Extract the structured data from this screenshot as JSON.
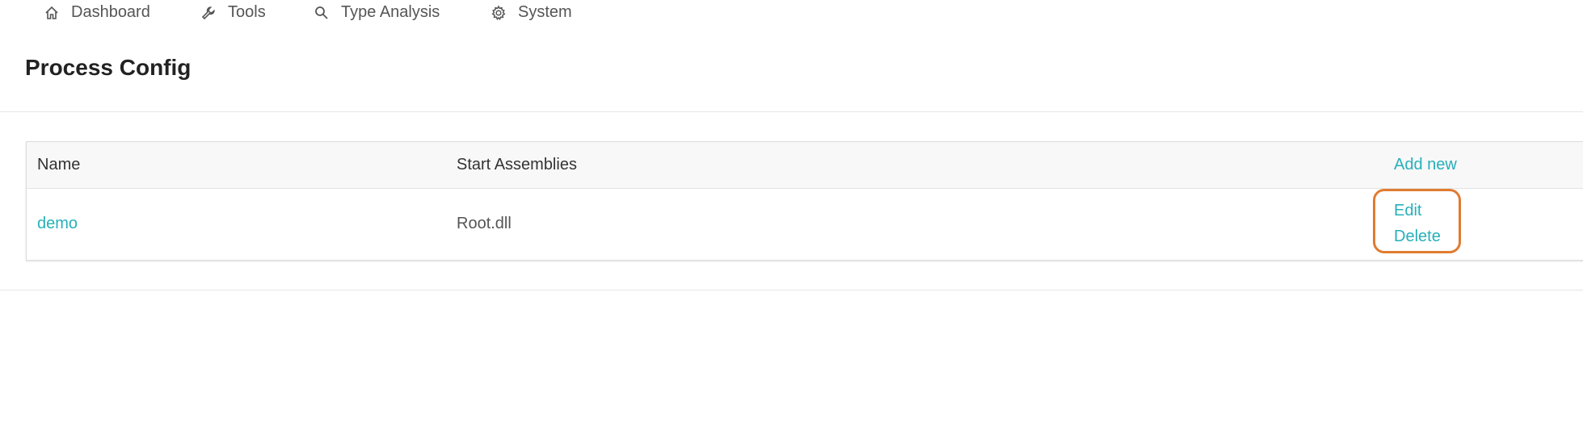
{
  "nav": {
    "items": [
      {
        "label": "Dashboard",
        "icon": "home-icon"
      },
      {
        "label": "Tools",
        "icon": "wrench-icon"
      },
      {
        "label": "Type Analysis",
        "icon": "search-icon"
      },
      {
        "label": "System",
        "icon": "gear-icon"
      }
    ]
  },
  "page": {
    "title": "Process Config"
  },
  "table": {
    "columns": [
      "Name",
      "Start Assemblies"
    ],
    "add_new_label": "Add new",
    "rows": [
      {
        "name": "demo",
        "start_assemblies": "Root.dll",
        "edit_label": "Edit",
        "delete_label": "Delete"
      }
    ]
  },
  "colors": {
    "accent": "#26b0ba",
    "highlight": "#e07b30"
  }
}
